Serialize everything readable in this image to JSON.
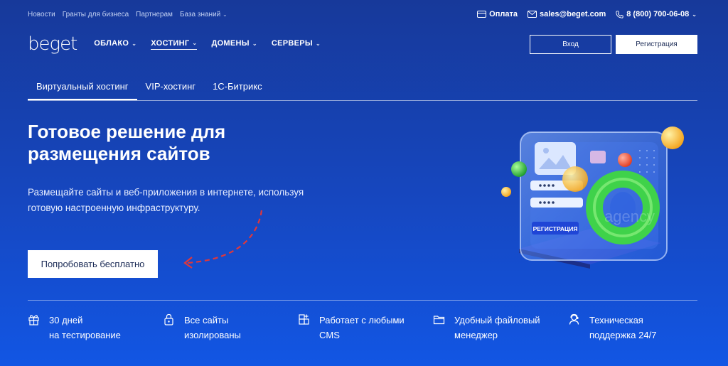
{
  "topbar": {
    "links": [
      "Новости",
      "Гранты для бизнеса",
      "Партнерам",
      "База знаний"
    ],
    "payment": "Оплата",
    "email": "sales@beget.com",
    "phone": "8 (800) 700-06-08"
  },
  "nav": {
    "logo": "beget",
    "items": [
      "ОБЛАКО",
      "ХОСТИНГ",
      "ДОМЕНЫ",
      "СЕРВЕРЫ"
    ],
    "login": "Вход",
    "register": "Регистрация"
  },
  "tabs": [
    "Виртуальный хостинг",
    "VIP-хостинг",
    "1С-Битрикс"
  ],
  "hero": {
    "title_line1": "Готовое решение для",
    "title_line2": "размещения сайтов",
    "subtitle_line1": "Размещайте сайты и веб-приложения в интернете, используя",
    "subtitle_line2": "готовую настроенную инфраструктуру.",
    "cta": "Попробовать бесплатно",
    "illustration_label": "РЕГИСТРАЦИЯ",
    "watermark": "agency"
  },
  "features": [
    {
      "line1": "30 дней",
      "line2": "на тестирование",
      "icon": "gift-icon"
    },
    {
      "line1": "Все сайты",
      "line2": "изолированы",
      "icon": "lock-icon"
    },
    {
      "line1": "Работает с любыми",
      "line2": "CMS",
      "icon": "blocks-icon"
    },
    {
      "line1": "Удобный файловый",
      "line2": "менеджер",
      "icon": "folder-icon"
    },
    {
      "line1": "Техническая",
      "line2": "поддержка 24/7",
      "icon": "support-icon"
    }
  ],
  "colors": {
    "background": "#1647c0",
    "accent_arrow": "#e0373b"
  }
}
